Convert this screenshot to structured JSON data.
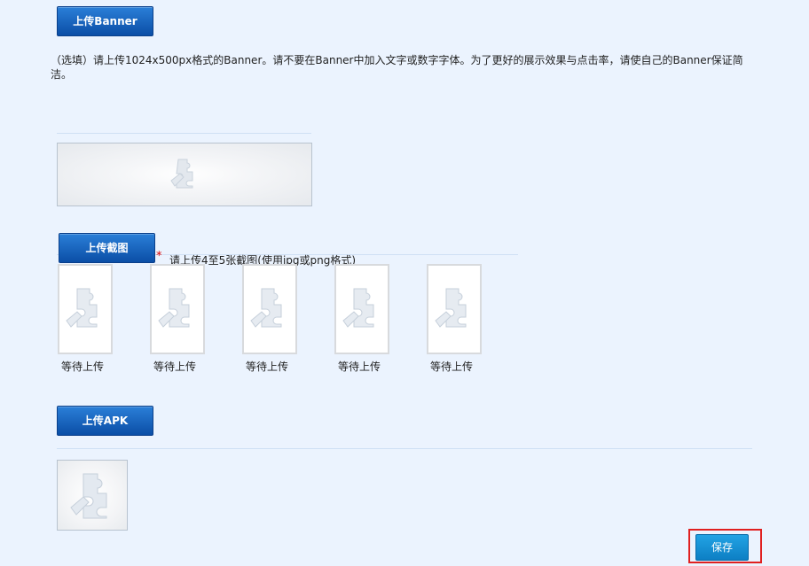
{
  "banner_section": {
    "upload_button": "上传Banner",
    "description": "（选填）请上传1024x500px格式的Banner。请不要在Banner中加入文字或数字字体。为了更好的展示效果与点击率，请使自己的Banner保证简洁。",
    "placeholder_icon": "puzzle-piece-icon"
  },
  "screenshot_section": {
    "upload_button": "上传截图",
    "required_mark": "*",
    "requirement_text": "请上传4至5张截图(使用jpg或png格式)",
    "slots": [
      {
        "label": "等待上传"
      },
      {
        "label": "等待上传"
      },
      {
        "label": "等待上传"
      },
      {
        "label": "等待上传"
      },
      {
        "label": "等待上传"
      }
    ],
    "placeholder_icon": "puzzle-piece-icon"
  },
  "apk_section": {
    "upload_button": "上传APK",
    "placeholder_icon": "puzzle-piece-icon"
  },
  "actions": {
    "save_button": "保存",
    "highlight_color": "#e02020"
  },
  "colors": {
    "background": "#ebf3fe",
    "button_blue": "#0b4ea6",
    "save_blue": "#0d7fc4"
  }
}
